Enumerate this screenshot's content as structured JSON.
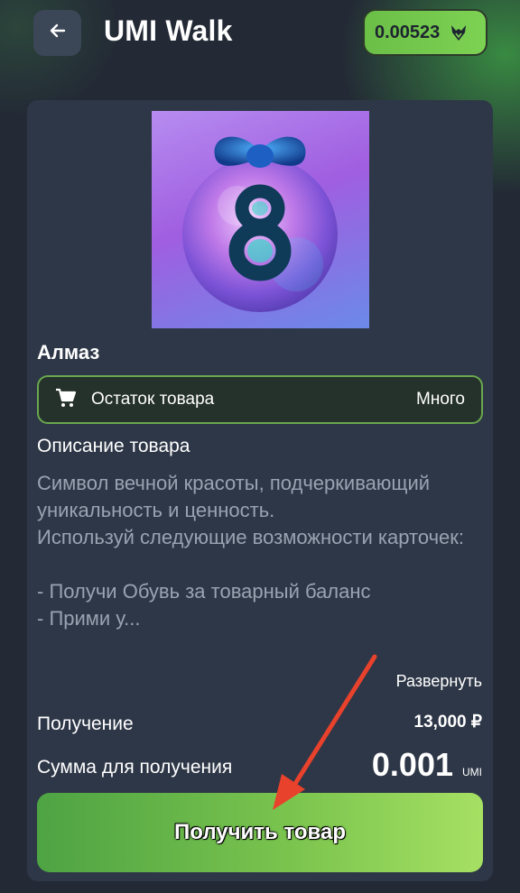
{
  "header": {
    "title": "UMI Walk",
    "balance": "0.00523",
    "back_icon": "arrow-left-icon",
    "balance_icon": "fox-head-icon"
  },
  "product": {
    "image_icon": "ornament-8-ball-icon",
    "name": "Алмаз",
    "stock_label": "Остаток товара",
    "stock_value": "Много",
    "description_heading": "Описание товара",
    "description": "Символ вечной красоты, подчеркивающий уникальность и ценность.\nИспользуй следующие возможности карточек:\n\n- Получи Обувь за товарный баланс\n- Прими у...",
    "expand_label": "Развернуть",
    "receive_label": "Получение",
    "receive_value": "13,000 ₽",
    "sum_label": "Сумма для получения",
    "sum_value": "0.001",
    "sum_unit": "UMI",
    "button_label": "Получить товар"
  },
  "colors": {
    "accent_green": "#7dd253",
    "annotation_arrow": "#e8412c",
    "background": "#232a35",
    "card": "#2e3747"
  }
}
